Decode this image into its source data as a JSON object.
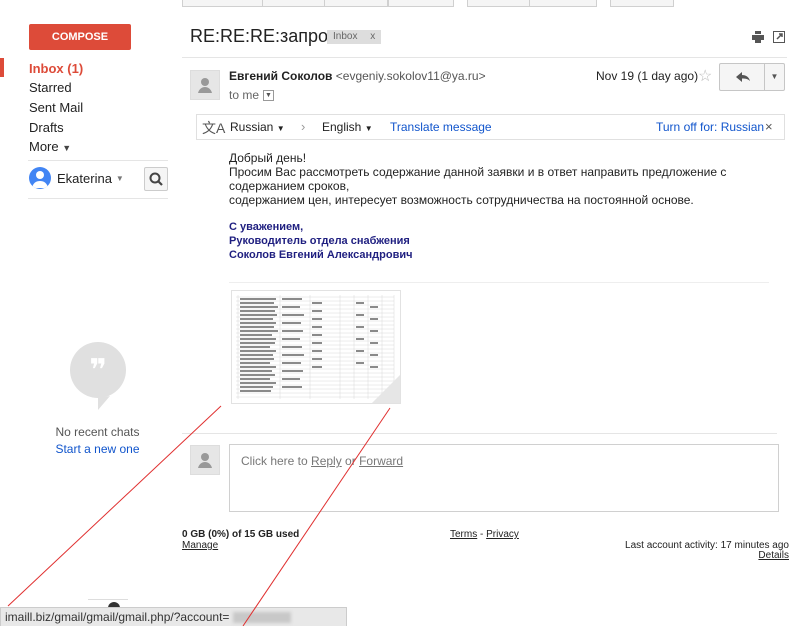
{
  "sidebar": {
    "compose_label": "COMPOSE",
    "items": [
      {
        "label": "Inbox (1)",
        "active": true
      },
      {
        "label": "Starred"
      },
      {
        "label": "Sent Mail"
      },
      {
        "label": "Drafts"
      },
      {
        "label": "More"
      }
    ],
    "user_name": "Ekaterina",
    "chats_empty": "No recent chats",
    "start_chat": "Start a new one"
  },
  "email": {
    "subject": "RE:RE:RE:запрос",
    "label": "Inbox",
    "label_close": "x",
    "sender_name": "Евгений Соколов",
    "sender_email": "<evgeniy.sokolov11@ya.ru>",
    "to": "to me",
    "date": "Nov 19 (1 day ago)"
  },
  "translate": {
    "source_lang": "Russian",
    "target_lang": "English",
    "translate_link": "Translate message",
    "turn_off": "Turn off for: Russian",
    "close": "×"
  },
  "body": {
    "lines": [
      "Добрый день!",
      "Просим Вас рассмотреть содержание данной заявки и в ответ направить предложение с",
      "содержанием сроков,",
      "содержанием цен, интересует возможность сотрудничества на постоянной основе."
    ],
    "signature": [
      "С уважением,",
      "Руководитель отдела снабжения",
      "Соколов Евгений Александрович"
    ]
  },
  "reply": {
    "prefix": "Click here to ",
    "reply_link": "Reply",
    "or": " or ",
    "forward_link": "Forward"
  },
  "footer": {
    "storage": "0 GB (0%) of 15 GB used",
    "manage": "Manage",
    "terms": "Terms",
    "sep": " - ",
    "privacy": "Privacy",
    "activity": "Last account activity: 17 minutes ago",
    "details": "Details"
  },
  "statusbar": {
    "url": "imaill.biz/gmail/gmail/gmail.php/?account="
  },
  "colors": {
    "compose_bg": "#dd4b39",
    "link": "#1155cc",
    "signature": "#1f1f80",
    "annotation_lines": "#e03030"
  }
}
